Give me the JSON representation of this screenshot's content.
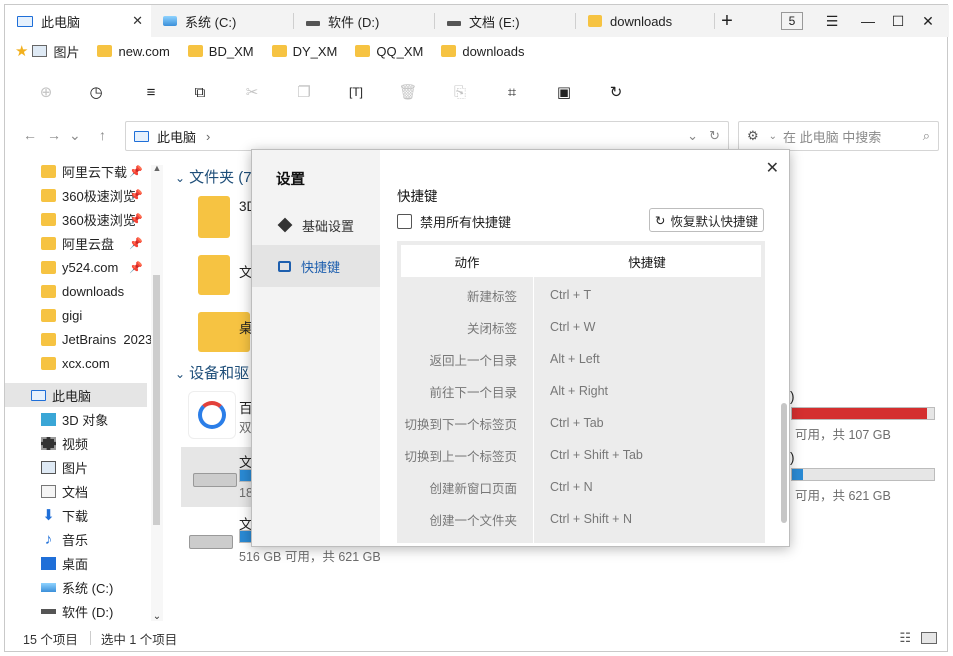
{
  "tabs": [
    {
      "label": "此电脑",
      "icon": "computer-icon",
      "active": true
    },
    {
      "label": "系统 (C:)",
      "icon": "system-drive-icon"
    },
    {
      "label": "软件 (D:)",
      "icon": "drive-icon"
    },
    {
      "label": "文档 (E:)",
      "icon": "drive-icon"
    },
    {
      "label": "downloads",
      "icon": "folder-icon"
    }
  ],
  "tab_close": "✕",
  "new_tab": "+",
  "window_count": "5",
  "bookmarks": [
    "图片",
    "new.com",
    "BD_XM",
    "DY_XM",
    "QQ_XM",
    "downloads"
  ],
  "address": {
    "path": "此电脑",
    "search_placeholder": "在 此电脑 中搜索"
  },
  "sidebar": {
    "pinned": [
      {
        "label": "阿里云下载",
        "pinned": true
      },
      {
        "label": "360极速浏览",
        "pinned": true
      },
      {
        "label": "360极速浏览",
        "pinned": true
      },
      {
        "label": "阿里云盘",
        "pinned": true
      },
      {
        "label": "y524.com",
        "pinned": true
      },
      {
        "label": "downloads",
        "pinned": false
      },
      {
        "label": "gigi",
        "pinned": false
      },
      {
        "label": "JetBrains  2023",
        "pinned": false
      },
      {
        "label": "xcx.com",
        "pinned": false
      }
    ],
    "this_pc": "此电脑",
    "pc_items": [
      "3D 对象",
      "视频",
      "图片",
      "文档",
      "下载",
      "音乐",
      "桌面",
      "系统 (C:)",
      "软件 (D:)"
    ]
  },
  "main": {
    "folders_header": "文件夹 (7",
    "folders": [
      "3D",
      "文",
      "桌"
    ],
    "devices_header": "设备和驱",
    "devices": [
      {
        "name": "百",
        "sub": "双"
      },
      {
        "name": "文",
        "sub": "18"
      },
      {
        "name": "文",
        "sub": "516 GB 可用，共 621 GB",
        "usage": 0.17
      }
    ],
    "right_drives": [
      {
        "label": ")",
        "sub": "可用，共 107 GB",
        "usage": 0.95,
        "color": "#d42f2f"
      },
      {
        "label": ")",
        "sub": "可用，共 621 GB",
        "usage": 0.08,
        "color": "#2a8ad4"
      }
    ]
  },
  "status": {
    "count": "15 个项目",
    "selected": "选中 1 个项目"
  },
  "dialog": {
    "title": "设置",
    "nav": [
      {
        "label": "基础设置",
        "selected": false
      },
      {
        "label": "快捷键",
        "selected": true
      }
    ],
    "section_title": "快捷键",
    "disable_all": "禁用所有快捷键",
    "reset_button": "恢复默认快捷键",
    "headers": {
      "action": "动作",
      "shortcut": "快捷键"
    },
    "rows": [
      {
        "action": "新建标签",
        "shortcut": "Ctrl + T"
      },
      {
        "action": "关闭标签",
        "shortcut": "Ctrl + W"
      },
      {
        "action": "返回上一个目录",
        "shortcut": "Alt + Left"
      },
      {
        "action": "前往下一个目录",
        "shortcut": "Alt + Right"
      },
      {
        "action": "切换到下一个标签页",
        "shortcut": "Ctrl + Tab"
      },
      {
        "action": "切换到上一个标签页",
        "shortcut": "Ctrl + Shift + Tab"
      },
      {
        "action": "创建新窗口页面",
        "shortcut": "Ctrl + N"
      },
      {
        "action": "创建一个文件夹",
        "shortcut": "Ctrl + Shift + N"
      }
    ]
  }
}
